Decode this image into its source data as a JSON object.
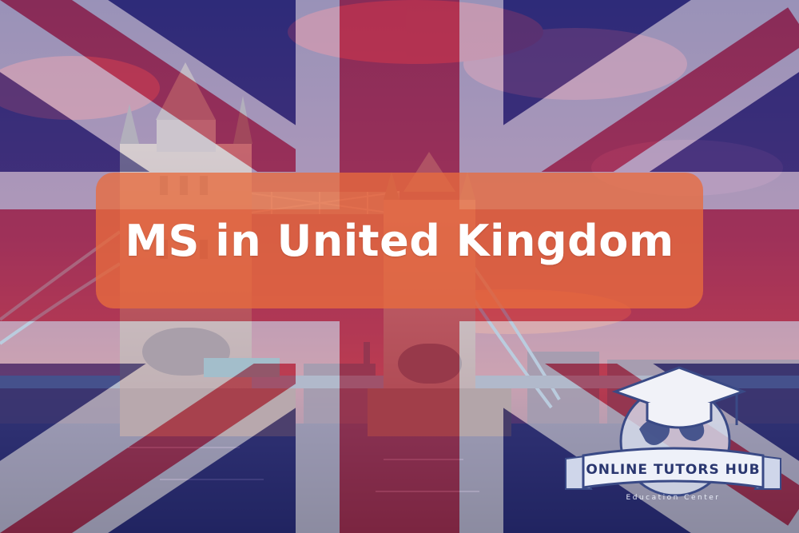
{
  "banner": {
    "title": "MS in United Kingdom"
  },
  "logo": {
    "name": "ONLINE TUTORS HUB",
    "tagline": "Education Center"
  },
  "colors": {
    "flag_blue": "#2e2f7a",
    "flag_red": "#c8283a",
    "flag_white": "#e9e4ee",
    "banner_orange": "#e86c3e",
    "title_text": "#ffffff"
  }
}
